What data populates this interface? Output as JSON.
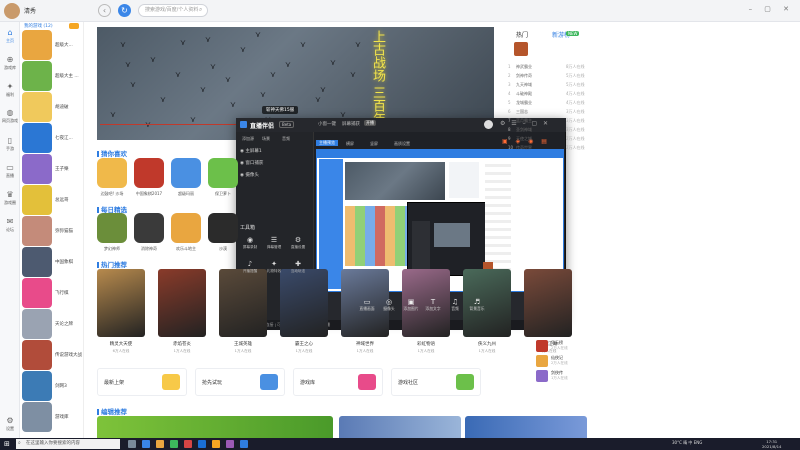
{
  "topbar": {
    "username": "清秀",
    "search_placeholder": "搜索游戏/百度/个人资料",
    "controls": "– ▢ ✕"
  },
  "rail": [
    {
      "label": "主页",
      "icon": "home-icon"
    },
    {
      "label": "游戏库",
      "icon": "gamepad-icon"
    },
    {
      "label": "福利",
      "icon": "gift-icon"
    },
    {
      "label": "网页游戏",
      "icon": "globe-icon"
    },
    {
      "label": "手游",
      "icon": "phone-icon"
    },
    {
      "label": "直播",
      "icon": "tv-icon"
    },
    {
      "label": "游戏圈",
      "icon": "crown-icon"
    },
    {
      "label": "论坛",
      "icon": "chat-icon"
    },
    {
      "label": "设置",
      "icon": "gear-icon"
    }
  ],
  "friends": {
    "title": "我的游戏 (12)",
    "items": [
      {
        "name": "超级大...",
        "color": "#e9a640"
      },
      {
        "name": "超级大主 ...",
        "color": "#6db34a"
      },
      {
        "name": "胡迪破",
        "color": "#f0c95c"
      },
      {
        "name": "七夜江...",
        "color": "#2b77d4"
      },
      {
        "name": "王子樂",
        "color": "#8b6ac9"
      },
      {
        "name": "总远哥",
        "color": "#e3c03a"
      },
      {
        "name": "弥弥猫猫",
        "color": "#c48b7a"
      },
      {
        "name": "中国象棋",
        "color": "#4d5a70"
      },
      {
        "name": "飞行棋",
        "color": "#e84b8a"
      },
      {
        "name": "天论之牌",
        "color": "#9aa3b2"
      },
      {
        "name": "传说游戏大战",
        "color": "#b14c3a"
      },
      {
        "name": "剑网3",
        "color": "#3c7bb5"
      },
      {
        "name": "游戏库",
        "color": "#7e8fa3"
      }
    ]
  },
  "banner": {
    "calligraphy": "上古战场 三百年守",
    "caption": "斩神天佛15服"
  },
  "sections": {
    "guess": "猜你喜欢",
    "daily": "每日精选",
    "hot": "热门推荐",
    "edit": "编辑推荐"
  },
  "guess_games": [
    {
      "name": "边鼓吧! 沙场",
      "color": "#f0b94a"
    },
    {
      "name": "中国象棋2017",
      "color": "#c0392b"
    },
    {
      "name": "超级玛丽",
      "color": "#4a90e2"
    },
    {
      "name": "保卫萝卜",
      "color": "#6cc04a"
    }
  ],
  "daily_games": [
    {
      "name": "梦幻神师",
      "color": "#6b8e3a"
    },
    {
      "name": "消除神奇",
      "color": "#3a3a3a"
    },
    {
      "name": "欢乐斗地主",
      "color": "#e9a640"
    },
    {
      "name": "沙漠",
      "color": "#2b2b2b"
    }
  ],
  "hot_games": [
    {
      "name": "精灵大天使",
      "sub": "6万人在线",
      "color": "#b78a4d"
    },
    {
      "name": "赤焰苍炎",
      "sub": "1万人在线",
      "color": "#8a3b2a"
    },
    {
      "name": "王城英雄",
      "sub": "1万人在线",
      "color": "#5a4a3a"
    },
    {
      "name": "霸王之心",
      "sub": "1万人在线",
      "color": "#3a4a6a"
    },
    {
      "name": "神域世界",
      "sub": "1万人在线",
      "color": "#6a7a9a"
    },
    {
      "name": "彩虹物语",
      "sub": "1万人在线",
      "color": "#9a6a8a"
    },
    {
      "name": "侠义九州",
      "sub": "1万人在线",
      "color": "#4a6a5a"
    },
    {
      "name": "魔界江湖",
      "sub": "1万人在线",
      "color": "#7a4a3a"
    }
  ],
  "tiles": [
    {
      "label": "最新上架",
      "color": "#f7c948"
    },
    {
      "label": "抢先试玩",
      "color": "#4a90e2"
    },
    {
      "label": "游戏库",
      "color": "#e84b8a"
    },
    {
      "label": "游戏社区",
      "color": "#6cc04a"
    }
  ],
  "right_panel": {
    "tab1": "热门",
    "tab2": "新游榜",
    "new_badge": "NEW",
    "rows": [
      {
        "n": "1",
        "t": "神武霸业",
        "v": "8万人在线"
      },
      {
        "n": "2",
        "t": "剑神传奇",
        "v": "5万人在线"
      },
      {
        "n": "3",
        "t": "九天神域",
        "v": "5万人在线"
      },
      {
        "n": "4",
        "t": "斗破神殿",
        "v": "4万人在线"
      },
      {
        "n": "5",
        "t": "龙城霸业",
        "v": "4万人在线"
      },
      {
        "n": "6",
        "t": "三国志",
        "v": "3万人在线"
      },
      {
        "n": "7",
        "t": "蓝月霸主",
        "v": "3万人在线"
      },
      {
        "n": "8",
        "t": "圣剑神域",
        "v": "3万人在线"
      },
      {
        "n": "9",
        "t": "天使之城",
        "v": "2万人在线"
      },
      {
        "n": "10",
        "t": "传奇世界",
        "v": "2万人在线"
      }
    ],
    "bottom": [
      {
        "t": "风云榜",
        "v": "2万人在线"
      },
      {
        "t": "仙侠记",
        "v": "2万人在线"
      },
      {
        "t": "剑侠传",
        "v": "1万人在线"
      }
    ]
  },
  "overlay": {
    "logo": "直播伴侣",
    "version": "Beta",
    "tabs": [
      "小窗一键",
      "屏幕捕获",
      "开播"
    ],
    "toolbar": [
      "添加源",
      "场景",
      "音频"
    ],
    "sources": [
      "◉ 主屏幕1",
      "◉ 窗口捕获",
      "◉ 摄像头"
    ],
    "tool_title": "工具箱",
    "tools": [
      {
        "label": "屏幕录制",
        "icon": "record-icon"
      },
      {
        "label": "弹幕管理",
        "icon": "danmaku-icon"
      },
      {
        "label": "直播设置",
        "icon": "settings-icon"
      },
      {
        "label": "开播提醒",
        "icon": "bell-icon"
      },
      {
        "label": "礼物特效",
        "icon": "gift-icon"
      },
      {
        "label": "互动玩法",
        "icon": "game-icon"
      }
    ],
    "preview_tabs": [
      "主播预览",
      "横屏",
      "竖屏",
      "画质设置"
    ],
    "bottom_buttons": [
      {
        "label": "直播画面",
        "icon": "screen-icon"
      },
      {
        "label": "摄像头",
        "icon": "camera-icon"
      },
      {
        "label": "添加图片",
        "icon": "image-icon"
      },
      {
        "label": "添加文字",
        "icon": "text-icon"
      },
      {
        "label": "音频",
        "icon": "mic-icon"
      },
      {
        "label": "背景音乐",
        "icon": "music-icon"
      }
    ],
    "start_label": "开始直播",
    "status": "当前直播间已连接 | 可随时开始直播 | 点击开始直播"
  },
  "taskbar": {
    "search": "在这里输入你要搜索的内容",
    "tray": "30°C 晴 中 ENG",
    "clock": "17:31\n2021/8/14"
  }
}
